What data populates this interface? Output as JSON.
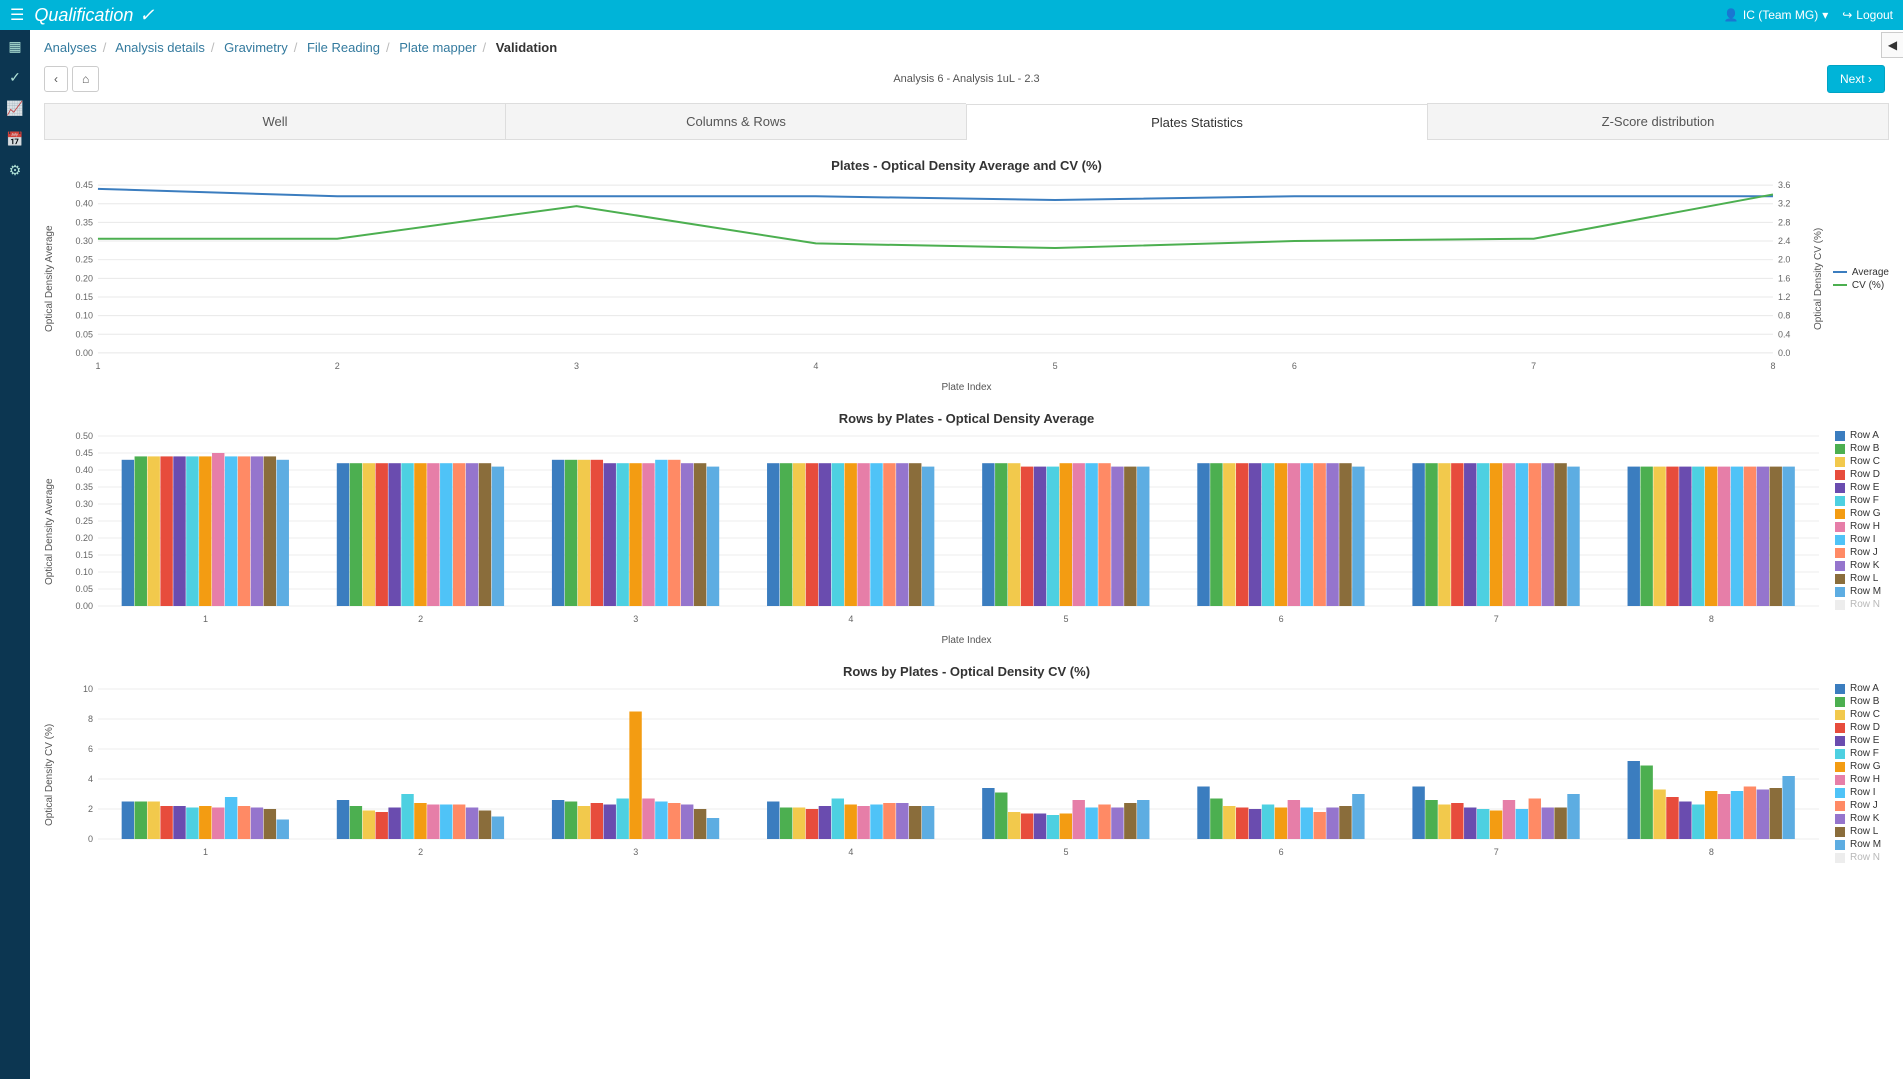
{
  "header": {
    "title": "Qualification",
    "user_label": "IC (Team MG)",
    "logout_label": "Logout"
  },
  "breadcrumbs": {
    "items": [
      "Analyses",
      "Analysis details",
      "Gravimetry",
      "File Reading",
      "Plate mapper"
    ],
    "current": "Validation"
  },
  "controls": {
    "subtitle": "Analysis 6 - Analysis 1uL - 2.3",
    "next_label": "Next"
  },
  "tabs": {
    "items": [
      {
        "label": "Well"
      },
      {
        "label": "Columns & Rows"
      },
      {
        "label": "Plates Statistics"
      },
      {
        "label": "Z-Score distribution"
      }
    ],
    "active_index": 2
  },
  "colors": {
    "blue": "#3b7dbf",
    "green": "#4caf50",
    "palette": [
      "#3b7dbf",
      "#4caf50",
      "#f2c94c",
      "#e74c3c",
      "#6a4caf",
      "#4dd0e1",
      "#f39c12",
      "#e67ea8",
      "#4fc3f7",
      "#ff8a65",
      "#9575cd",
      "#8a6d3b",
      "#5dade2"
    ]
  },
  "chart_data": [
    {
      "id": "avg_cv",
      "type": "line",
      "title": "Plates - Optical Density Average and CV (%)",
      "xlabel": "Plate Index",
      "y1_label": "Optical Density Average",
      "y2_label": "Optical Density CV (%)",
      "x": [
        1,
        2,
        3,
        4,
        5,
        6,
        7,
        8
      ],
      "y1_ticks": [
        0.0,
        0.05,
        0.1,
        0.15,
        0.2,
        0.25,
        0.3,
        0.35,
        0.4,
        0.45
      ],
      "y2_ticks": [
        0.0,
        0.4,
        0.8,
        1.2,
        1.6,
        2.0,
        2.4,
        2.8,
        3.2,
        3.6
      ],
      "series": [
        {
          "name": "Average",
          "axis": "y1",
          "color": "#3b7dbf",
          "values": [
            0.44,
            0.42,
            0.42,
            0.42,
            0.41,
            0.42,
            0.42,
            0.42
          ]
        },
        {
          "name": "CV (%)",
          "axis": "y2",
          "color": "#4caf50",
          "values": [
            2.45,
            2.45,
            3.15,
            2.35,
            2.25,
            2.4,
            2.45,
            3.4
          ]
        }
      ]
    },
    {
      "id": "rows_avg",
      "type": "bar",
      "title": "Rows by Plates - Optical Density Average",
      "xlabel": "Plate Index",
      "ylabel": "Optical Density Average",
      "y_ticks": [
        0.0,
        0.05,
        0.1,
        0.15,
        0.2,
        0.25,
        0.3,
        0.35,
        0.4,
        0.45,
        0.5
      ],
      "categories": [
        1,
        2,
        3,
        4,
        5,
        6,
        7,
        8
      ],
      "legend_rows": [
        "Row A",
        "Row B",
        "Row C",
        "Row D",
        "Row E",
        "Row F",
        "Row G",
        "Row H",
        "Row I",
        "Row J",
        "Row K",
        "Row L",
        "Row M",
        "Row N"
      ],
      "series": [
        {
          "name": "Row A",
          "values": [
            0.43,
            0.42,
            0.43,
            0.42,
            0.42,
            0.42,
            0.42,
            0.41
          ]
        },
        {
          "name": "Row B",
          "values": [
            0.44,
            0.42,
            0.43,
            0.42,
            0.42,
            0.42,
            0.42,
            0.41
          ]
        },
        {
          "name": "Row C",
          "values": [
            0.44,
            0.42,
            0.43,
            0.42,
            0.42,
            0.42,
            0.42,
            0.41
          ]
        },
        {
          "name": "Row D",
          "values": [
            0.44,
            0.42,
            0.43,
            0.42,
            0.41,
            0.42,
            0.42,
            0.41
          ]
        },
        {
          "name": "Row E",
          "values": [
            0.44,
            0.42,
            0.42,
            0.42,
            0.41,
            0.42,
            0.42,
            0.41
          ]
        },
        {
          "name": "Row F",
          "values": [
            0.44,
            0.42,
            0.42,
            0.42,
            0.41,
            0.42,
            0.42,
            0.41
          ]
        },
        {
          "name": "Row G",
          "values": [
            0.44,
            0.42,
            0.42,
            0.42,
            0.42,
            0.42,
            0.42,
            0.41
          ]
        },
        {
          "name": "Row H",
          "values": [
            0.45,
            0.42,
            0.42,
            0.42,
            0.42,
            0.42,
            0.42,
            0.41
          ]
        },
        {
          "name": "Row I",
          "values": [
            0.44,
            0.42,
            0.43,
            0.42,
            0.42,
            0.42,
            0.42,
            0.41
          ]
        },
        {
          "name": "Row J",
          "values": [
            0.44,
            0.42,
            0.43,
            0.42,
            0.42,
            0.42,
            0.42,
            0.41
          ]
        },
        {
          "name": "Row K",
          "values": [
            0.44,
            0.42,
            0.42,
            0.42,
            0.41,
            0.42,
            0.42,
            0.41
          ]
        },
        {
          "name": "Row L",
          "values": [
            0.44,
            0.42,
            0.42,
            0.42,
            0.41,
            0.42,
            0.42,
            0.41
          ]
        },
        {
          "name": "Row M",
          "values": [
            0.43,
            0.41,
            0.41,
            0.41,
            0.41,
            0.41,
            0.41,
            0.41
          ]
        }
      ]
    },
    {
      "id": "rows_cv",
      "type": "bar",
      "title": "Rows by Plates - Optical Density CV (%)",
      "xlabel": "Plate Index",
      "ylabel": "Optical Density CV (%)",
      "y_ticks": [
        0,
        2,
        4,
        6,
        8,
        10
      ],
      "categories": [
        1,
        2,
        3,
        4,
        5,
        6,
        7,
        8
      ],
      "legend_rows": [
        "Row A",
        "Row B",
        "Row C",
        "Row D",
        "Row E",
        "Row F",
        "Row G",
        "Row H",
        "Row I",
        "Row J",
        "Row K",
        "Row L",
        "Row M",
        "Row N"
      ],
      "series": [
        {
          "name": "Row A",
          "values": [
            2.5,
            2.6,
            2.6,
            2.5,
            3.4,
            3.5,
            3.5,
            5.2
          ]
        },
        {
          "name": "Row B",
          "values": [
            2.5,
            2.2,
            2.5,
            2.1,
            3.1,
            2.7,
            2.6,
            4.9
          ]
        },
        {
          "name": "Row C",
          "values": [
            2.5,
            1.9,
            2.2,
            2.1,
            1.8,
            2.2,
            2.3,
            3.3
          ]
        },
        {
          "name": "Row D",
          "values": [
            2.2,
            1.8,
            2.4,
            2.0,
            1.7,
            2.1,
            2.4,
            2.8
          ]
        },
        {
          "name": "Row E",
          "values": [
            2.2,
            2.1,
            2.3,
            2.2,
            1.7,
            2.0,
            2.1,
            2.5
          ]
        },
        {
          "name": "Row F",
          "values": [
            2.1,
            3.0,
            2.7,
            2.7,
            1.6,
            2.3,
            2.0,
            2.3
          ]
        },
        {
          "name": "Row G",
          "values": [
            2.2,
            2.4,
            8.5,
            2.3,
            1.7,
            2.1,
            1.9,
            3.2
          ]
        },
        {
          "name": "Row H",
          "values": [
            2.1,
            2.3,
            2.7,
            2.2,
            2.6,
            2.6,
            2.6,
            3.0
          ]
        },
        {
          "name": "Row I",
          "values": [
            2.8,
            2.3,
            2.5,
            2.3,
            2.1,
            2.1,
            2.0,
            3.2
          ]
        },
        {
          "name": "Row J",
          "values": [
            2.2,
            2.3,
            2.4,
            2.4,
            2.3,
            1.8,
            2.7,
            3.5
          ]
        },
        {
          "name": "Row K",
          "values": [
            2.1,
            2.1,
            2.3,
            2.4,
            2.1,
            2.1,
            2.1,
            3.3
          ]
        },
        {
          "name": "Row L",
          "values": [
            2.0,
            1.9,
            2.0,
            2.2,
            2.4,
            2.2,
            2.1,
            3.4
          ]
        },
        {
          "name": "Row M",
          "values": [
            1.3,
            1.5,
            1.4,
            2.2,
            2.6,
            3.0,
            3.0,
            4.2
          ]
        }
      ]
    }
  ]
}
